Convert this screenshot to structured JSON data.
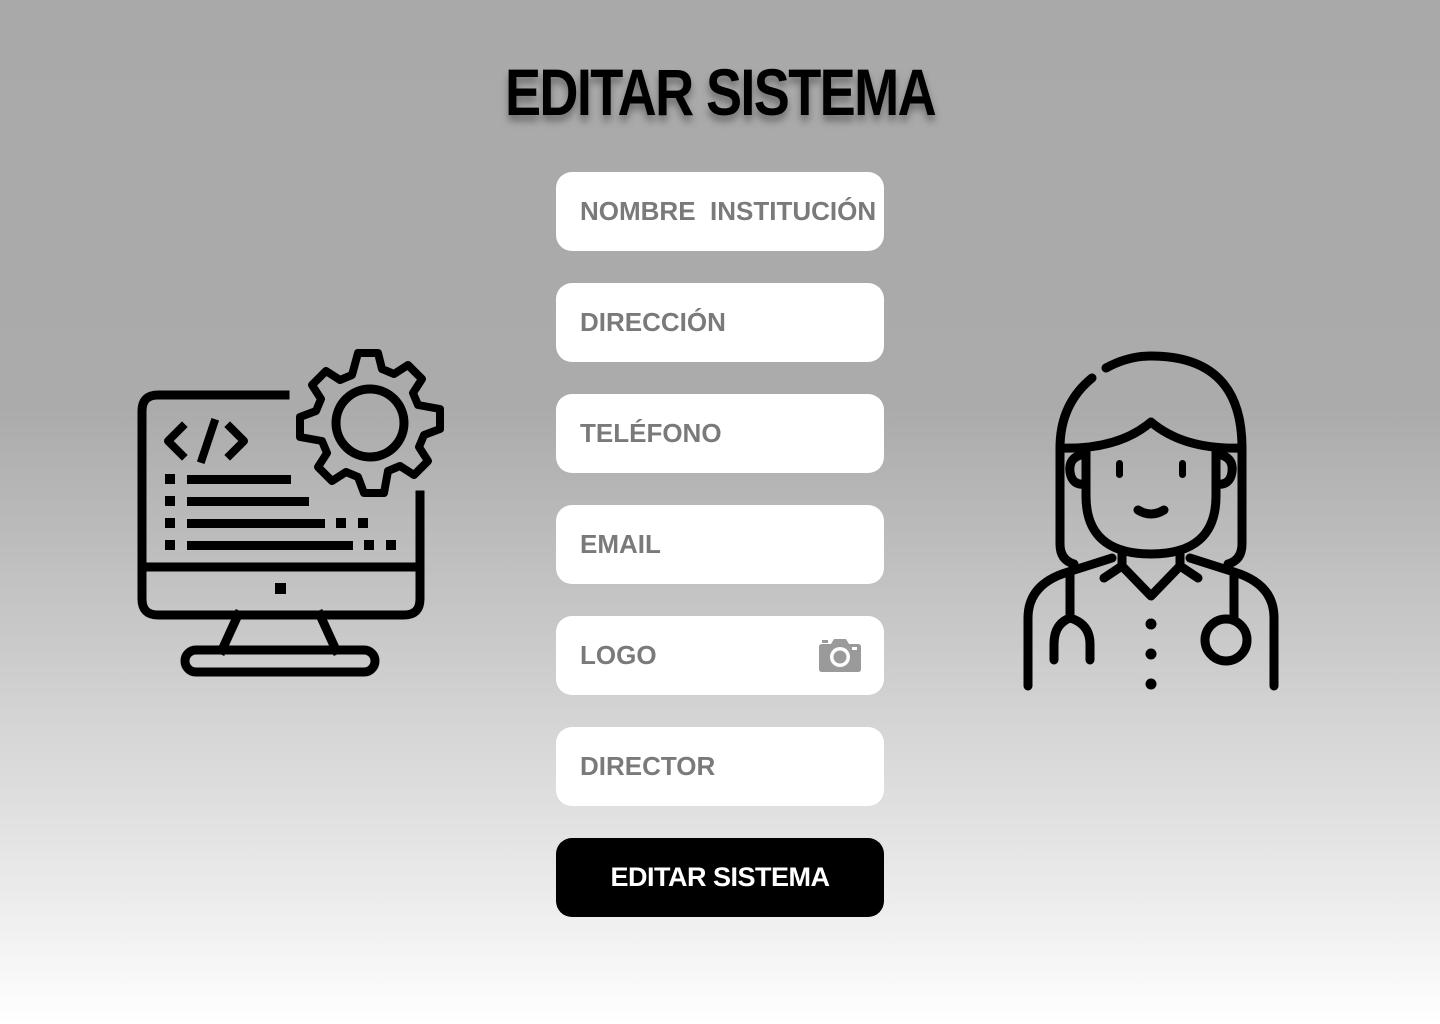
{
  "page": {
    "title": "EDITAR SISTEMA"
  },
  "form": {
    "fields": [
      {
        "placeholder": "NOMBRE  INSTITUCIÓN",
        "value": ""
      },
      {
        "placeholder": "DIRECCIÓN",
        "value": ""
      },
      {
        "placeholder": "TELÉFONO",
        "value": ""
      },
      {
        "placeholder": "EMAIL",
        "value": ""
      },
      {
        "placeholder": "LOGO",
        "value": ""
      },
      {
        "placeholder": "DIRECTOR",
        "value": ""
      }
    ],
    "submit_label": "EDITAR SISTEMA"
  },
  "icons": {
    "logo_upload": "camera-icon",
    "left_illustration": "computer-settings-icon",
    "right_illustration": "doctor-icon"
  },
  "colors": {
    "button_bg": "#000000",
    "button_text": "#ffffff",
    "field_bg": "#ffffff",
    "placeholder": "#7a7a7a",
    "camera_icon": "#9a9a9a"
  }
}
